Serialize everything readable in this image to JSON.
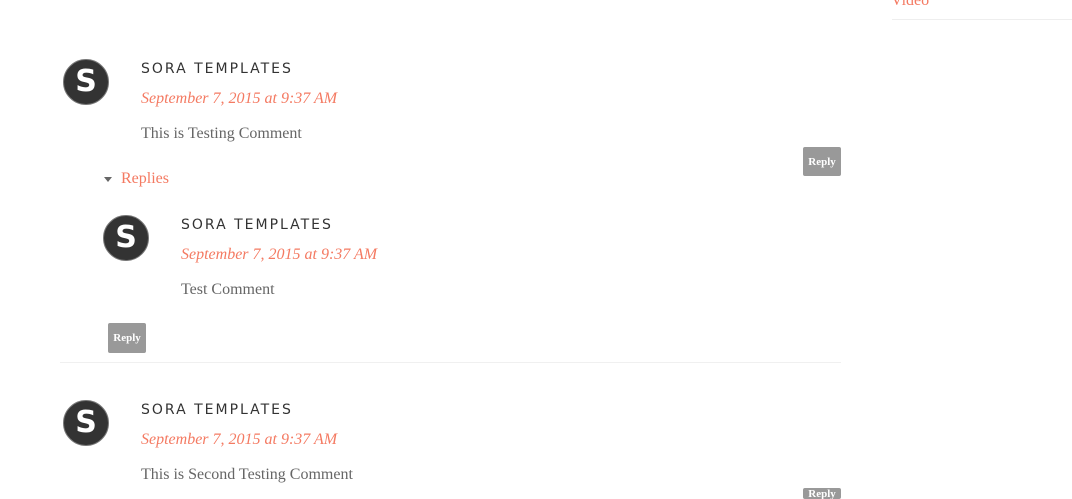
{
  "sidebar": {
    "link_label": "Video"
  },
  "comments": [
    {
      "avatar_letter": "S",
      "author": "SORA TEMPLATES",
      "timestamp": "September 7, 2015 at 9:37 AM",
      "text": "This is Testing Comment",
      "reply_label": "Reply",
      "replies_label": "Replies",
      "replies": [
        {
          "avatar_letter": "S",
          "author": "SORA TEMPLATES",
          "timestamp": "September 7, 2015 at 9:37 AM",
          "text": "Test Comment",
          "reply_label": "Reply"
        }
      ]
    },
    {
      "avatar_letter": "S",
      "author": "SORA TEMPLATES",
      "timestamp": "September 7, 2015 at 9:37 AM",
      "text": "This is Second Testing Comment",
      "reply_label": "Reply"
    }
  ],
  "colors": {
    "accent": "#f47a62",
    "reply_button": "#999999",
    "avatar": "#333333"
  }
}
